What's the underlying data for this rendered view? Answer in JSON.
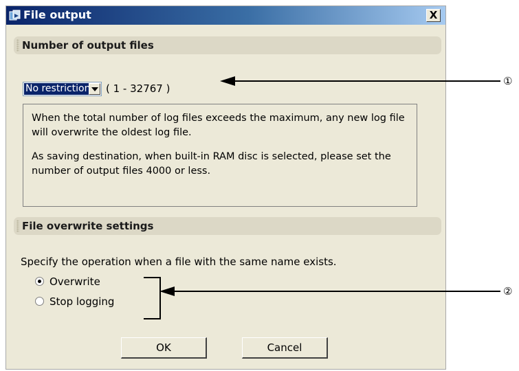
{
  "dialog": {
    "title": "File output",
    "close_label": "X"
  },
  "output_files": {
    "section_title": "Number of output files",
    "selected_value": "No restriction",
    "range": "( 1 - 32767 )",
    "info_para1": "When the total number of log files exceeds the maximum, any new log file will overwrite the oldest log file.",
    "info_para2": "As saving destination, when built-in RAM disc is selected, please set the number of output files 4000 or less."
  },
  "overwrite": {
    "section_title": "File overwrite settings",
    "description": "Specify the operation when a file with the same name exists.",
    "options": [
      {
        "label": "Overwrite",
        "selected": true
      },
      {
        "label": "Stop logging",
        "selected": false
      }
    ]
  },
  "buttons": {
    "ok": "OK",
    "cancel": "Cancel"
  },
  "callouts": {
    "one": "①",
    "two": "②"
  }
}
